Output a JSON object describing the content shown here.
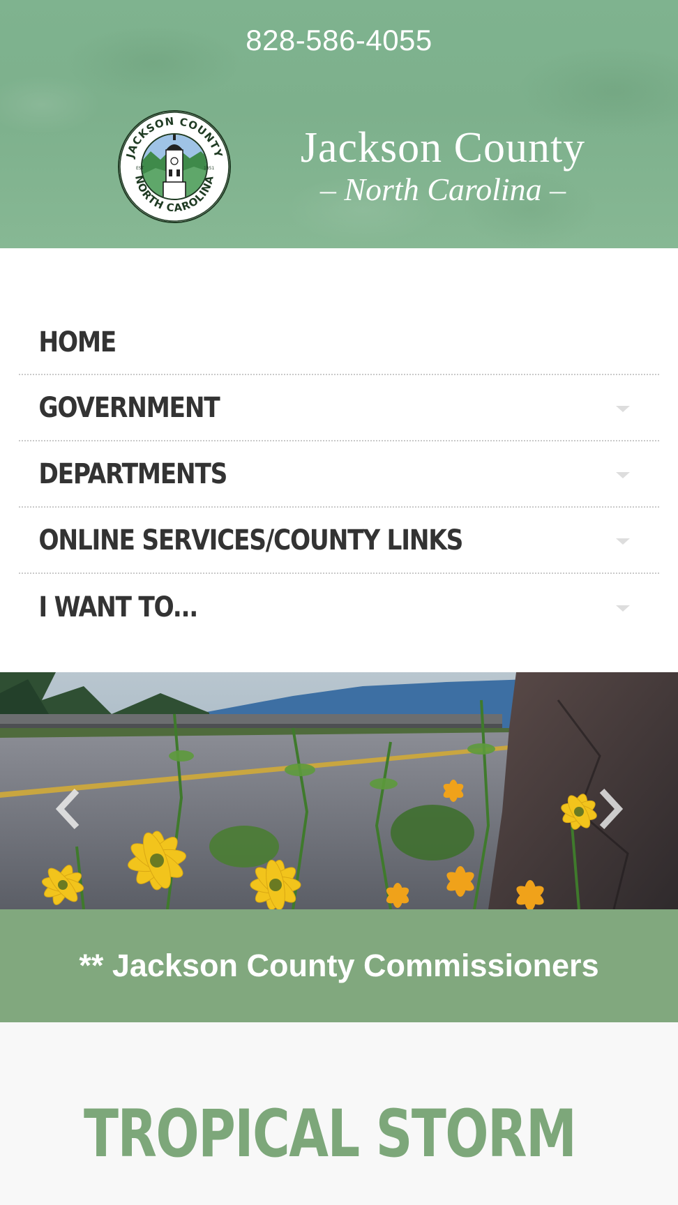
{
  "header": {
    "phone": "828-586-4055",
    "logo_title": "Jackson County",
    "logo_subtitle": "North Carolina",
    "seal": {
      "top_text": "JACKSON COUNTY",
      "bottom_text": "NORTH CAROLINA",
      "est_left": "EST",
      "est_right": "1851"
    },
    "colors": {
      "background": "#7fb38f",
      "text": "#ffffff"
    }
  },
  "nav": {
    "items": [
      {
        "label": "HOME",
        "has_dropdown": false
      },
      {
        "label": "GOVERNMENT",
        "has_dropdown": true
      },
      {
        "label": "DEPARTMENTS",
        "has_dropdown": true
      },
      {
        "label": "ONLINE SERVICES/COUNTY LINKS",
        "has_dropdown": true
      },
      {
        "label": "I WANT TO...",
        "has_dropdown": true
      }
    ]
  },
  "slider": {
    "prev_icon": "chevron-left-icon",
    "next_icon": "chevron-right-icon"
  },
  "caption": {
    "text": "** Jackson County Commissioners",
    "color": "#81a87e"
  },
  "article": {
    "headline": "TROPICAL STORM",
    "color": "#7da77a"
  }
}
